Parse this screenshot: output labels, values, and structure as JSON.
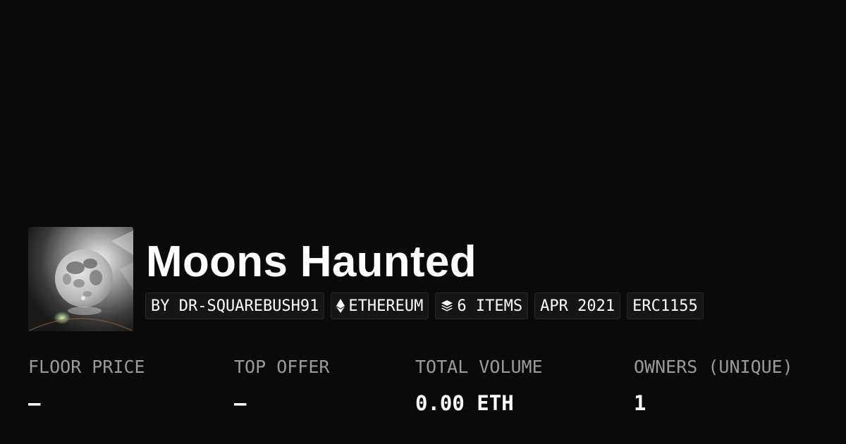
{
  "collection": {
    "title": "Moons Haunted",
    "avatar_icon": "full-moon-image"
  },
  "tags": {
    "creator": "BY DR-SQUAREBUSH91",
    "chain": "ETHEREUM",
    "chain_icon": "ethereum-icon",
    "items": "6 ITEMS",
    "items_icon": "layers-icon",
    "date": "APR 2021",
    "standard": "ERC1155"
  },
  "stats": {
    "floor_price": {
      "label": "FLOOR PRICE",
      "value": "—"
    },
    "top_offer": {
      "label": "TOP OFFER",
      "value": "—"
    },
    "total_volume": {
      "label": "TOTAL VOLUME",
      "value": "0.00 ETH"
    },
    "owners": {
      "label": "OWNERS (UNIQUE)",
      "value": "1"
    }
  },
  "colors": {
    "background": "#0a0a0a",
    "text": "#ffffff",
    "muted": "#9a9a9a",
    "tag_bg": "#161616"
  }
}
